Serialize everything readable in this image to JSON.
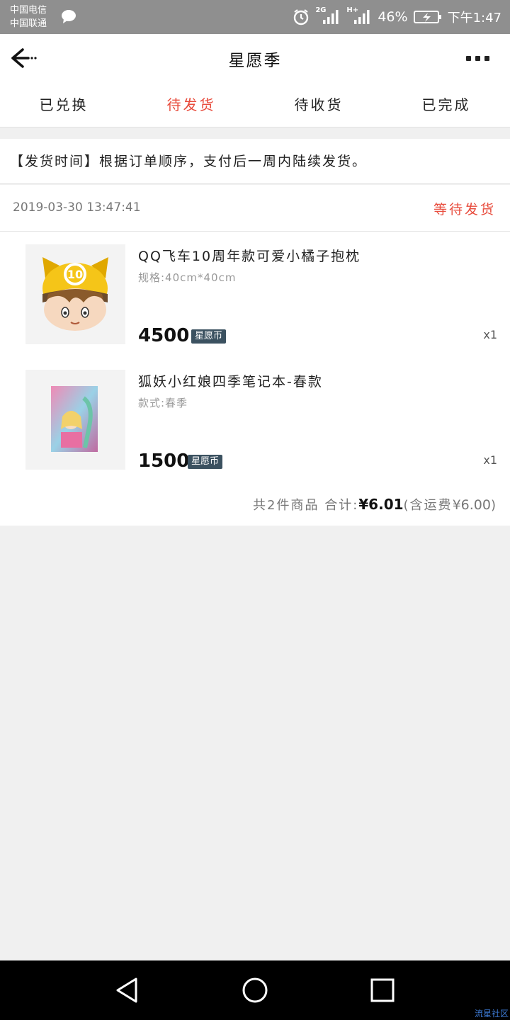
{
  "status_bar": {
    "carrier1": "中国电信",
    "carrier2": "中国联通",
    "network_2g": "2G",
    "network_h": "H+",
    "battery": "46%",
    "time": "下午1:47"
  },
  "header": {
    "title": "星愿季"
  },
  "tabs": [
    {
      "label": "已兑换",
      "active": false
    },
    {
      "label": "待发货",
      "active": true
    },
    {
      "label": "待收货",
      "active": false
    },
    {
      "label": "已完成",
      "active": false
    }
  ],
  "notice": "【发货时间】根据订单顺序，支付后一周内陆续发货。",
  "order": {
    "time": "2019-03-30 13:47:41",
    "status": "等待发货",
    "products": [
      {
        "name": "QQ飞车10周年款可爱小橘子抱枕",
        "spec": "规格:40cm*40cm",
        "price": "4500",
        "coin": "星愿币",
        "qty": "x1"
      },
      {
        "name": "狐妖小红娘四季笔记本-春款",
        "spec": "款式:春季",
        "price": "1500",
        "coin": "星愿币",
        "qty": "x1"
      }
    ],
    "summary": {
      "prefix": "共2件商品 合计:",
      "total": "¥6.01",
      "shipping_prefix": "(含运费",
      "shipping": "¥6.00",
      "shipping_suffix": ")"
    }
  },
  "watermark": "流星社区",
  "colors": {
    "accent": "#e84c3d",
    "coin_badge": "#3b5160",
    "status_bar": "#8f8f8f"
  }
}
